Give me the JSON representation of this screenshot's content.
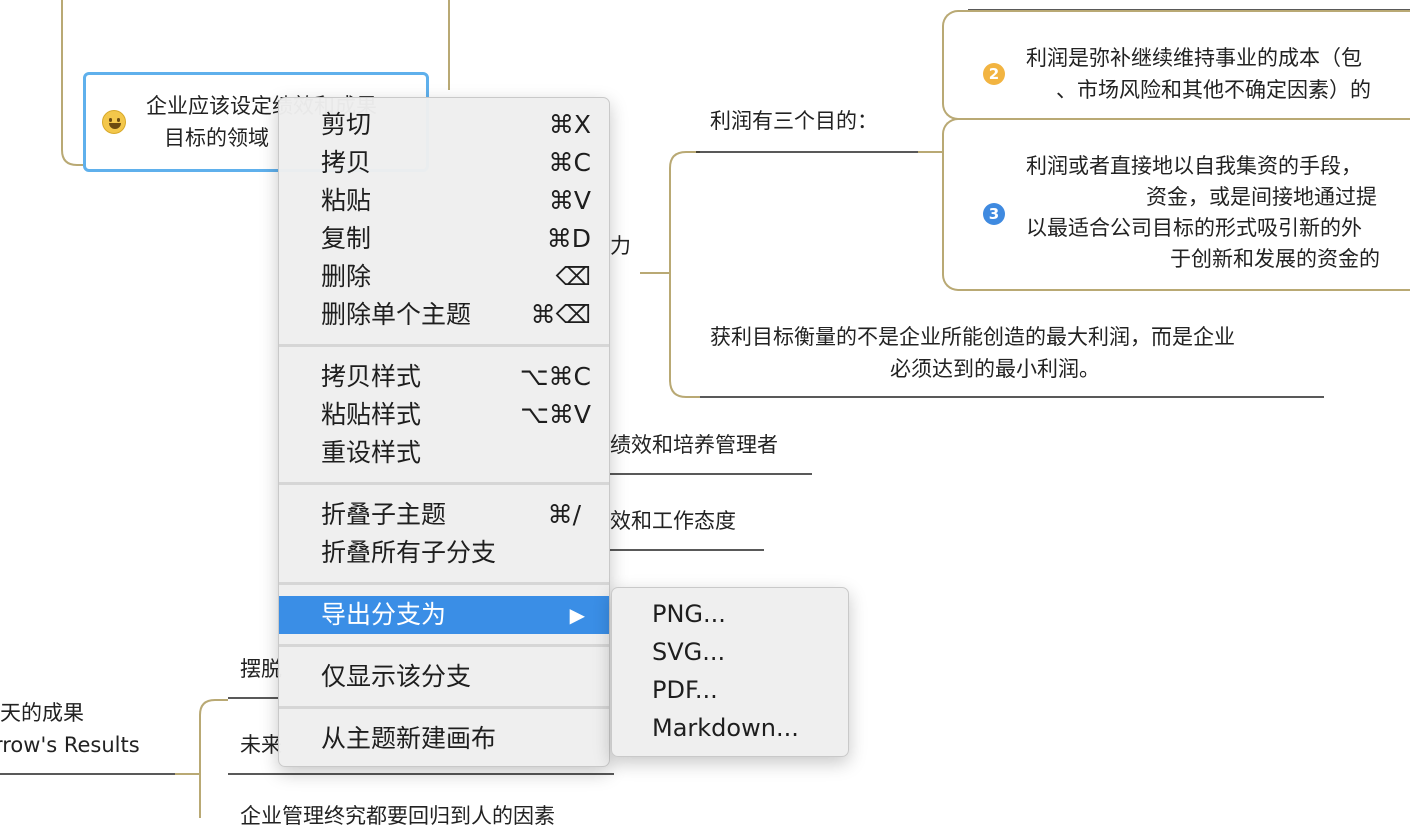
{
  "canvas": {
    "selected_node": {
      "line1": "企业应该设定绩效和成果",
      "line2": "目标的领域"
    },
    "profit_purposes_label": "利润有三个目的：",
    "purpose2": {
      "badge": "2",
      "line1": "利润是弥补继续维持事业的成本（包",
      "line2": "、市场风险和其他不确定因素）的"
    },
    "purpose3": {
      "badge": "3",
      "line1": "利润或者直接地以自我集资的手段，",
      "line2": "资金，或是间接地通过提",
      "line3": "以最适合公司目标的形式吸引新的外",
      "line4": "于创新和发展的资金的"
    },
    "profit_measure": {
      "line1": "获利目标衡量的不是企业所能创造的最大利润，而是企业",
      "line2": "必须达到的最小利润。"
    },
    "fragment_li": "力",
    "fragment_perf_mgr": "绩效和培养管理者",
    "fragment_perf_attitude": "效和工作态度",
    "fragment_baituo": "摆脱",
    "fragment_weilai": "未来",
    "left_node": {
      "line1": "天的成果",
      "line2": "rrow's Results"
    },
    "bottom_fragment": "企业管理终究都要回归到人的因素"
  },
  "context_menu": {
    "items": [
      {
        "label": "剪切",
        "shortcut": "⌘X"
      },
      {
        "label": "拷贝",
        "shortcut": "⌘C"
      },
      {
        "label": "粘贴",
        "shortcut": "⌘V"
      },
      {
        "label": "复制",
        "shortcut": "⌘D"
      },
      {
        "label": "删除",
        "shortcut": "⌫"
      },
      {
        "label": "删除单个主题",
        "shortcut": "⌘⌫"
      },
      {
        "label": "拷贝样式",
        "shortcut": "⌥⌘C"
      },
      {
        "label": "粘贴样式",
        "shortcut": "⌥⌘V"
      },
      {
        "label": "重设样式",
        "shortcut": ""
      },
      {
        "label": "折叠子主题",
        "shortcut": "⌘/"
      },
      {
        "label": "折叠所有子分支",
        "shortcut": ""
      },
      {
        "label": "导出分支为",
        "shortcut": "▶"
      },
      {
        "label": "仅显示该分支",
        "shortcut": ""
      },
      {
        "label": "从主题新建画布",
        "shortcut": ""
      }
    ]
  },
  "export_submenu": {
    "items": [
      "PNG...",
      "SVG...",
      "PDF...",
      "Markdown..."
    ]
  },
  "colors": {
    "branch_line": "#b9a974",
    "selection_border": "#5fb0ec",
    "menu_highlight": "#3a8ee6",
    "badge2": "#f2b441",
    "badge3": "#3f8ae0"
  }
}
